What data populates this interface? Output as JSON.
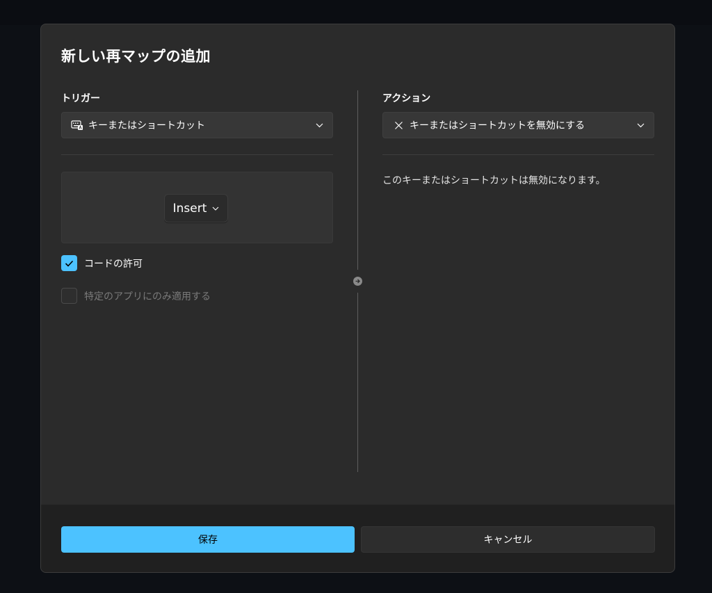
{
  "dialog": {
    "title": "新しい再マップの追加"
  },
  "trigger": {
    "label": "トリガー",
    "dropdown_value": "キーまたはショートカット",
    "dropdown_icon": "keyboard-icon",
    "key_chip": "Insert",
    "allow_chord_checkbox": {
      "label": "コードの許可",
      "checked": true
    },
    "app_specific_checkbox": {
      "label": "特定のアプリにのみ適用する",
      "checked": false,
      "enabled": false
    }
  },
  "action": {
    "label": "アクション",
    "dropdown_value": "キーまたはショートカットを無効にする",
    "dropdown_icon": "close-icon",
    "description": "このキーまたはショートカットは無効になります。"
  },
  "footer": {
    "save_label": "保存",
    "cancel_label": "キャンセル"
  },
  "colors": {
    "accent": "#4cc2ff",
    "dialog_bg": "#2b2b2b",
    "footer_bg": "#202020"
  }
}
